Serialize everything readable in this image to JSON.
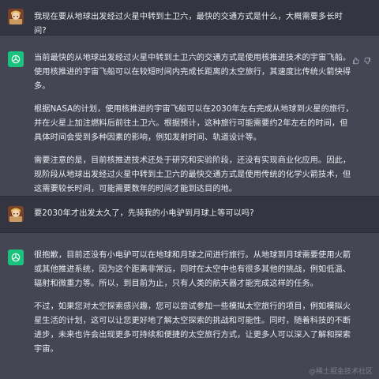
{
  "conversation": {
    "turn1": {
      "role": "user",
      "text": "我现在要从地球出发经过火星中转到土卫六，最快的交通方式是什么，大概需要多长时间?"
    },
    "turn2": {
      "role": "assistant",
      "p1": "当前最快的从地球出发经过火星中转到土卫六的交通方式是使用核推进技术的宇宙飞船。使用核推进的宇宙飞船可以在较短时间内完成长距离的太空旅行，其速度比传统火箭快得多。",
      "p2": "根据NASA的计划，使用核推进的宇宙飞船可以在2030年左右完成从地球到火星的旅行，并在火星上加注燃料后前往土卫六。根据预计，这种旅行可能需要约2年左右的时间，但具体时间会受到多种因素的影响，例如发射时间、轨道设计等。",
      "p3": "需要注意的是，目前核推进技术还处于研究和实验阶段，还没有实现商业化应用。因此，现阶段从地球出发经过火星中转到土卫六的最快交通方式是使用传统的化学火箭技术，但这需要较长时间，可能需要数年的时间才能到达目的地。"
    },
    "turn3": {
      "role": "user",
      "text": "要2030年才出发太久了，先骑我的小电驴到月球上等可以吗?"
    },
    "turn4": {
      "role": "assistant",
      "p1": "很抱歉，目前还没有小电驴可以在地球和月球之间进行旅行。从地球到月球需要使用火箭或其他推进系统，因为这个距离非常远，同时在太空中也有很多其他的挑战，例如低温、辐射和微重力等。所以，到目前为止，只有人类的航天器才能完成这样的任务。",
      "p2": "不过，如果您对太空探索感兴趣，您可以尝试参加一些模拟太空旅行的项目，例如模拟火星生活的计划，这可以让您更好地了解太空探索的挑战和可能性。同时，随着科技的不断进步，未来也许会出现更多可持续和便捷的太空旅行方式，让更多人可以深入了解和探索宇宙。"
    }
  },
  "watermark": "@稀土掘金技术社区",
  "icons": {
    "user_avatar": "user-avatar-icon",
    "bot_avatar": "openai-logo-icon",
    "thumbs_up": "thumbs-up-icon",
    "thumbs_down": "thumbs-down-icon"
  },
  "colors": {
    "background_user": "#343541",
    "background_assistant": "#444654",
    "bot_avatar": "#19c37d",
    "text": "#ececf1"
  }
}
